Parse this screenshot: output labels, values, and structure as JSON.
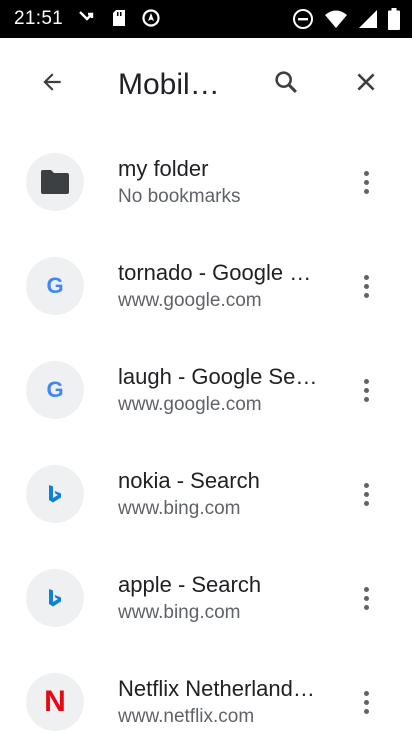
{
  "status_bar": {
    "time": "21:51",
    "left_icons": [
      "missed-call-icon",
      "sd-card-icon",
      "location-off-icon"
    ],
    "right_icons": [
      "do-not-disturb-icon",
      "wifi-icon",
      "signal-icon",
      "battery-icon"
    ]
  },
  "toolbar": {
    "title": "Mobile bookmarks",
    "back_icon": "arrow-back-icon",
    "search_icon": "search-icon",
    "close_icon": "close-icon"
  },
  "bookmarks": [
    {
      "title": "my folder",
      "subtitle": "No bookmarks",
      "icon": "folder-icon"
    },
    {
      "title": "tornado - Google Search",
      "subtitle": "www.google.com",
      "icon": "google-favicon",
      "icon_letter": "G"
    },
    {
      "title": "laugh - Google Search",
      "subtitle": "www.google.com",
      "icon": "google-favicon",
      "icon_letter": "G"
    },
    {
      "title": "nokia - Search",
      "subtitle": "www.bing.com",
      "icon": "bing-favicon",
      "icon_letter": "b"
    },
    {
      "title": "apple - Search",
      "subtitle": "www.bing.com",
      "icon": "bing-favicon",
      "icon_letter": "b"
    },
    {
      "title": "Netflix Netherlands - Watch TV Shows Online",
      "subtitle": "www.netflix.com",
      "icon": "netflix-favicon",
      "icon_letter": "N"
    }
  ],
  "colors": {
    "status_bar_bg": "#000000",
    "text_primary": "#202124",
    "text_secondary": "#5f6368",
    "avatar_bg": "#eef0f2",
    "google_blue": "#4285f4",
    "bing_blue": "#0f82d6",
    "netflix_red": "#e50914"
  }
}
